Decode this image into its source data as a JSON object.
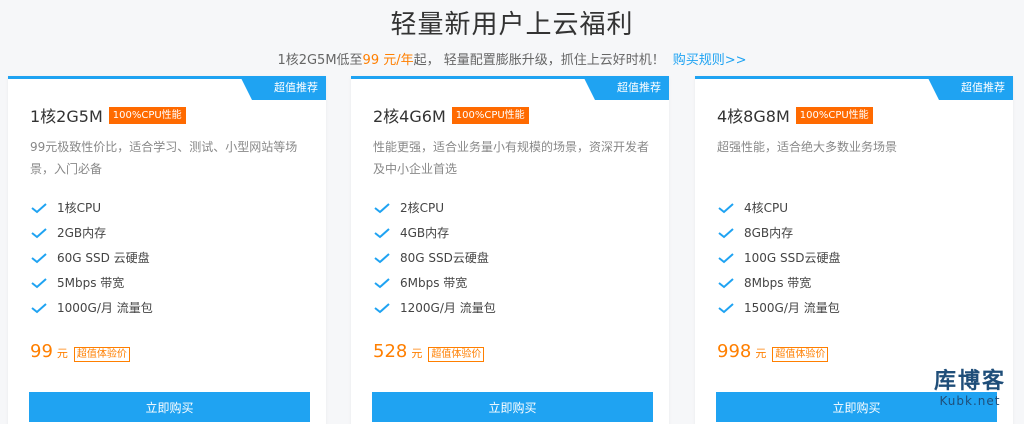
{
  "hero": {
    "title": "轻量新用户上云福利",
    "sub_prefix": "1核2G5M低至",
    "sub_price": "99 元/年",
    "sub_suffix": "起， 轻量配置膨胀升级，抓住上云好时机！",
    "rules_link": "购买规则>>"
  },
  "plans": [
    {
      "badge": "超值推荐",
      "name": "1核2G5M",
      "cpu_tag": "100%CPU性能",
      "desc": "99元极致性价比，适合学习、测试、小型网站等场景，入门必备",
      "features": [
        "1核CPU",
        "2GB内存",
        "60G SSD  云硬盘",
        "5Mbps 带宽",
        "1000G/月 流量包"
      ],
      "price": "99",
      "unit": "元",
      "price_tag": "超值体验价",
      "buy_label": "立即购买"
    },
    {
      "badge": "超值推荐",
      "name": "2核4G6M",
      "cpu_tag": "100%CPU性能",
      "desc": "性能更强，适合业务量小有规模的场景，资深开发者及中小企业首选",
      "features": [
        "2核CPU",
        "4GB内存",
        "80G SSD云硬盘",
        "6Mbps 带宽",
        "1200G/月 流量包"
      ],
      "price": "528",
      "unit": "元",
      "price_tag": "超值体验价",
      "buy_label": "立即购买"
    },
    {
      "badge": "超值推荐",
      "name": "4核8G8M",
      "cpu_tag": "100%CPU性能",
      "desc": "超强性能，适合绝大多数业务场景",
      "features": [
        "4核CPU",
        "8GB内存",
        "100G SSD云硬盘",
        "8Mbps 带宽",
        "1500G/月 流量包"
      ],
      "price": "998",
      "unit": "元",
      "price_tag": "超值体验价",
      "buy_label": "立即购买"
    }
  ],
  "watermark": {
    "cn": "库博客",
    "en": "Kubk.net"
  },
  "icons": {
    "check": "check-icon"
  },
  "colors": {
    "accent": "#1fa3f2",
    "price": "#ff7f00",
    "tag": "#ff6a00"
  }
}
